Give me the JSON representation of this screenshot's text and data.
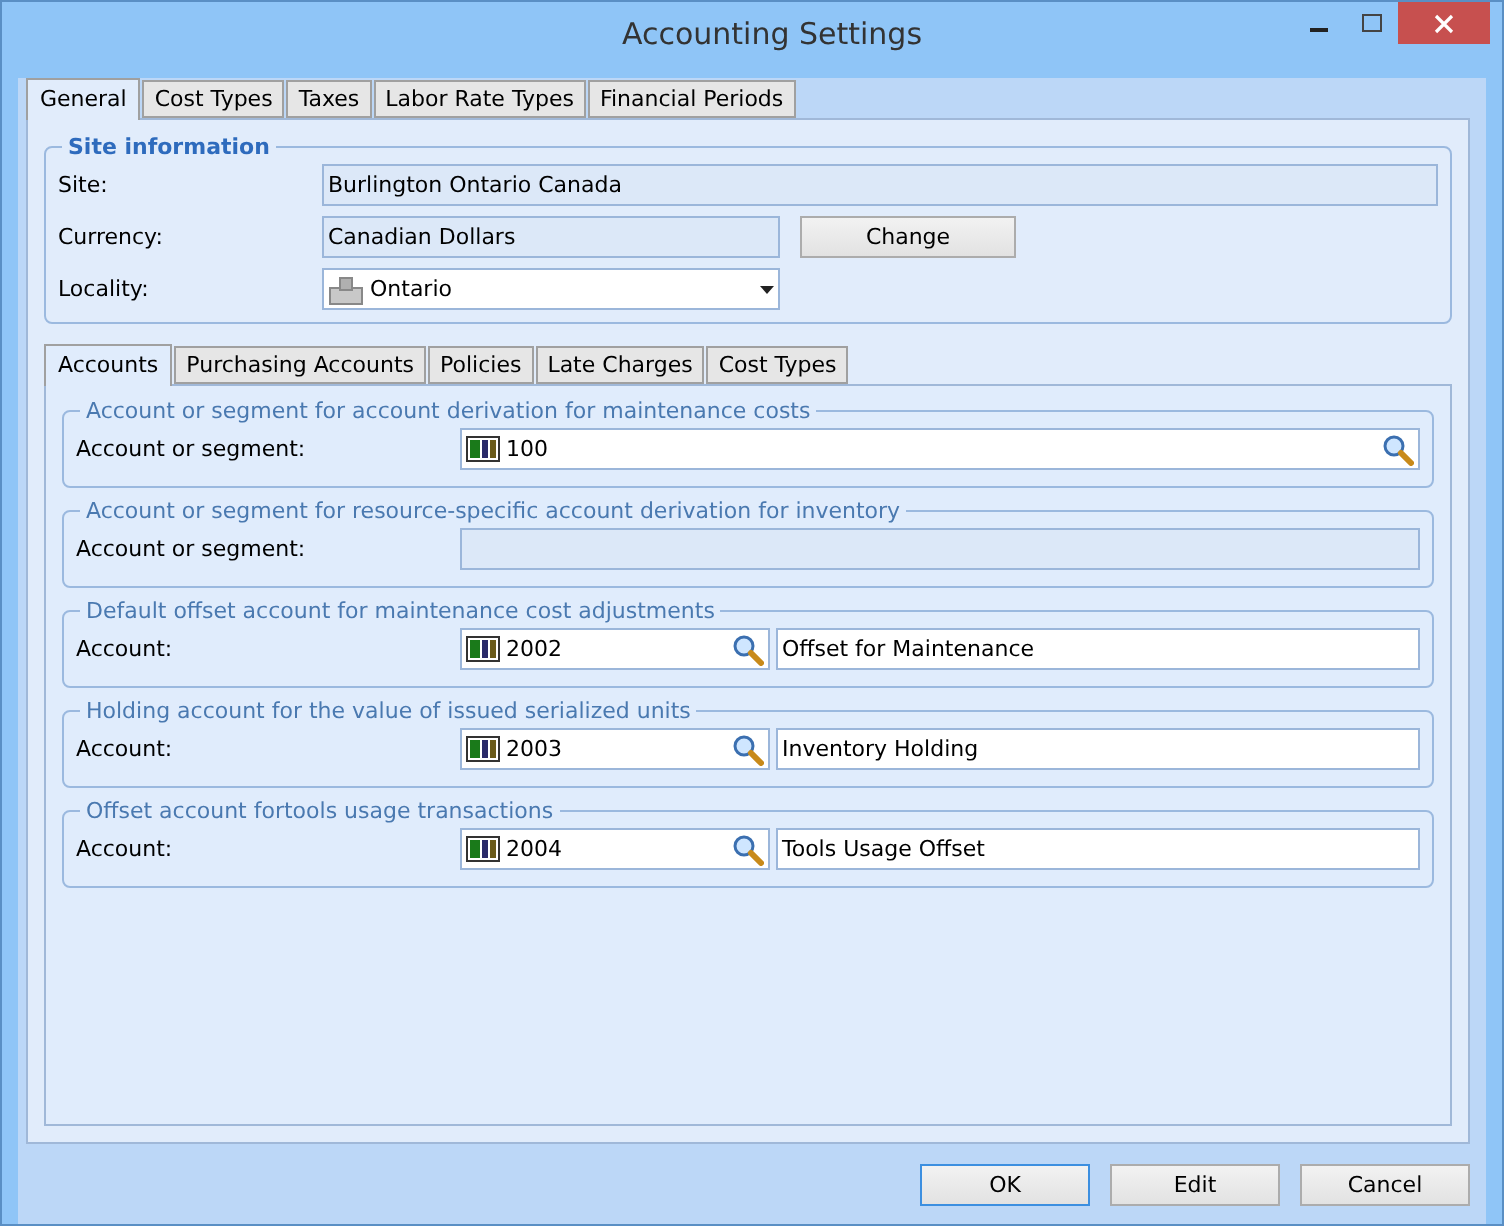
{
  "window": {
    "title": "Accounting Settings"
  },
  "tabs": [
    {
      "label": "General",
      "selected": true
    },
    {
      "label": "Cost Types",
      "selected": false
    },
    {
      "label": "Taxes",
      "selected": false
    },
    {
      "label": "Labor Rate Types",
      "selected": false
    },
    {
      "label": "Financial Periods",
      "selected": false
    }
  ],
  "site_information": {
    "title": "Site information",
    "site": {
      "label": "Site:",
      "value": "Burlington Ontario Canada"
    },
    "currency": {
      "label": "Currency:",
      "value": "Canadian Dollars",
      "button": "Change"
    },
    "locality": {
      "label": "Locality:",
      "value": "Ontario"
    }
  },
  "inner_tabs": [
    {
      "label": "Accounts",
      "selected": true
    },
    {
      "label": "Purchasing Accounts",
      "selected": false
    },
    {
      "label": "Policies",
      "selected": false
    },
    {
      "label": "Late Charges",
      "selected": false
    },
    {
      "label": "Cost Types",
      "selected": false
    }
  ],
  "account_groups": [
    {
      "kind": "wide",
      "title": "Account or segment for account derivation for maintenance costs",
      "label": "Account or segment:",
      "account": "100"
    },
    {
      "kind": "blank",
      "title": "Account or segment for resource-specific account derivation for inventory",
      "label": "Account or segment:"
    },
    {
      "kind": "split",
      "title": "Default offset account for maintenance cost adjustments",
      "label": "Account:",
      "account": "2002",
      "description": "Offset for Maintenance"
    },
    {
      "kind": "split",
      "title": "Holding account for the value of issued serialized units",
      "label": "Account:",
      "account": "2003",
      "description": "Inventory Holding"
    },
    {
      "kind": "split",
      "title": "Offset account fortools usage transactions",
      "label": "Account:",
      "account": "2004",
      "description": "Tools Usage Offset"
    }
  ],
  "buttons": [
    {
      "label": "OK",
      "selected": true
    },
    {
      "label": "Edit",
      "selected": false
    },
    {
      "label": "Cancel",
      "selected": false
    }
  ]
}
